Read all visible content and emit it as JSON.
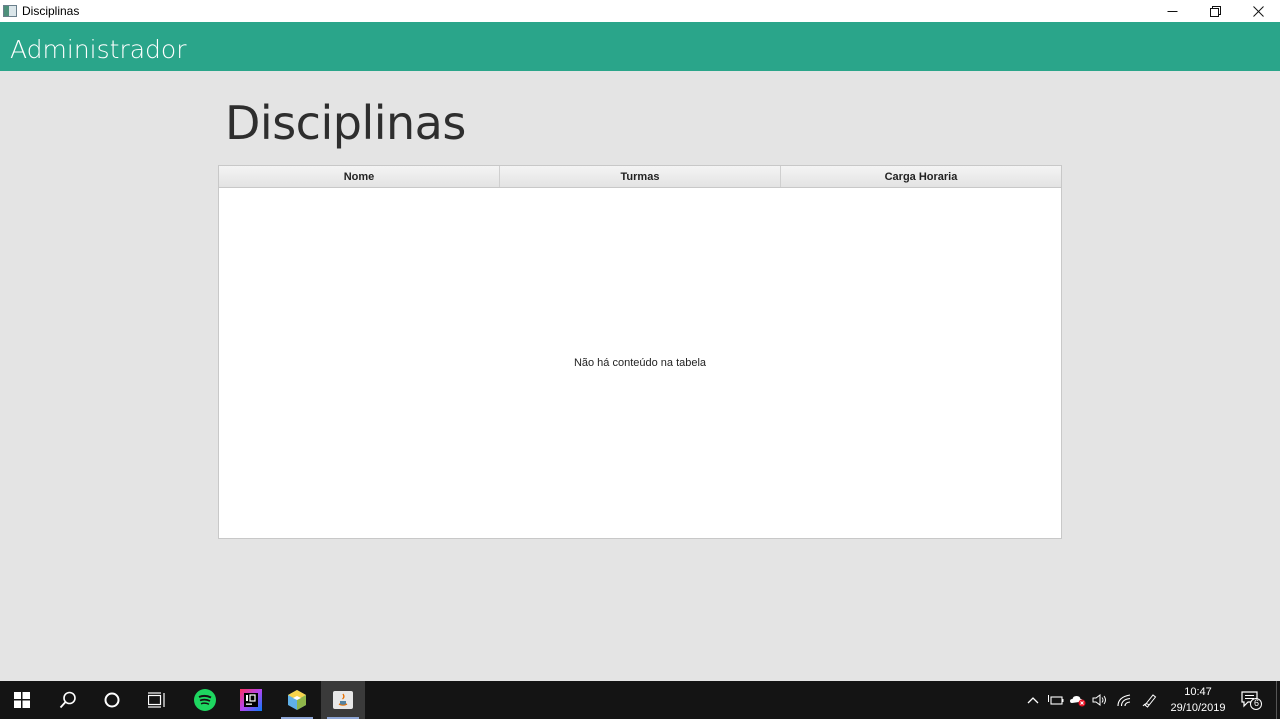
{
  "window": {
    "title": "Disciplinas",
    "controls": {
      "minimize": "—",
      "maximize": "❐",
      "close": "✕"
    }
  },
  "header": {
    "title": "Administrador"
  },
  "page": {
    "title": "Disciplinas"
  },
  "table": {
    "columns": [
      "Nome",
      "Turmas",
      "Carga Horaria"
    ],
    "empty_message": "Não há conteúdo na tabela"
  },
  "taskbar": {
    "apps": [
      "start-icon",
      "search-icon",
      "cortana-icon",
      "task-view-icon",
      "spotify-icon",
      "intellij-icon",
      "netbeans-icon",
      "java-icon"
    ],
    "clock": {
      "time": "10:47",
      "date": "29/10/2019"
    },
    "notifications_count": "6"
  },
  "colors": {
    "header": "#2aa58a",
    "background": "#e4e4e4",
    "taskbar": "#141414"
  }
}
